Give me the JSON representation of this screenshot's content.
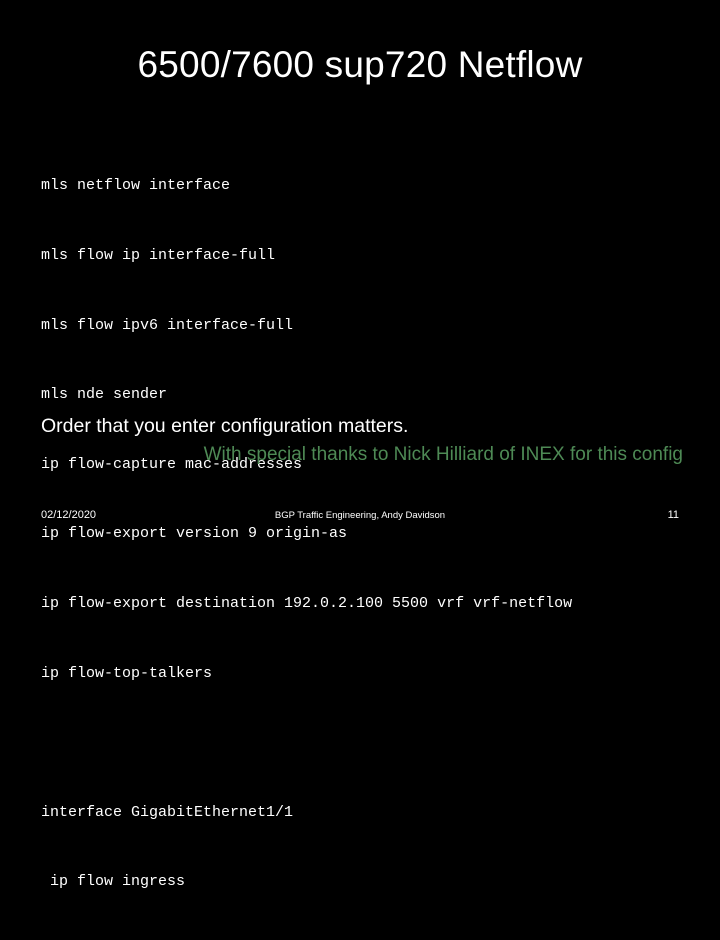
{
  "slide": {
    "title": "6500/7600 sup720 Netflow",
    "background_color": "#000000",
    "text_color": "#ffffff",
    "accent_color": "#4e8a55"
  },
  "code": {
    "lines": [
      "mls netflow interface",
      "mls flow ip interface-full",
      "mls flow ipv6 interface-full",
      "mls nde sender",
      "ip flow-capture mac-addresses",
      "ip flow-export version 9 origin-as",
      "ip flow-export destination 192.0.2.100 5500 vrf vrf-netflow",
      "ip flow-top-talkers",
      "",
      "interface GigabitEthernet1/1",
      " ip flow ingress"
    ]
  },
  "notes": {
    "primary": "Order that you enter configuration matters.",
    "credit": "With special thanks to Nick Hilliard of INEX for this config"
  },
  "footer": {
    "date": "02/12/2020",
    "center": "BGP Traffic Engineering, Andy Davidson",
    "page": "11"
  }
}
